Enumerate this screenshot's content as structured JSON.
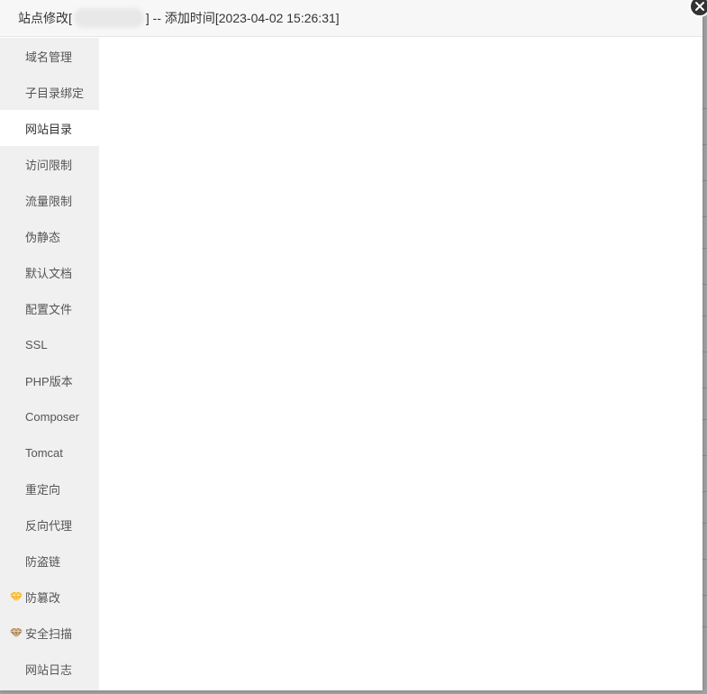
{
  "dialog": {
    "title_prefix": "站点修改[",
    "title_suffix": "] -- 添加时间[2023-04-02 15:26:31]",
    "close_icon": "close-icon"
  },
  "sidebar": {
    "items": [
      {
        "label": "域名管理"
      },
      {
        "label": "子目录绑定"
      },
      {
        "label": "网站目录"
      },
      {
        "label": "访问限制"
      },
      {
        "label": "流量限制"
      },
      {
        "label": "伪静态"
      },
      {
        "label": "默认文档"
      },
      {
        "label": "配置文件"
      },
      {
        "label": "SSL"
      },
      {
        "label": "PHP版本"
      },
      {
        "label": "Composer"
      },
      {
        "label": "Tomcat"
      },
      {
        "label": "重定向"
      },
      {
        "label": "反向代理"
      },
      {
        "label": "防盗链"
      },
      {
        "label": "防篡改",
        "icon": "gem-gold-icon"
      },
      {
        "label": "安全扫描",
        "icon": "gem-bronze-icon"
      },
      {
        "label": "网站日志"
      }
    ],
    "active_index": 2
  },
  "colors": {
    "gem_gold": "#f5b324",
    "gem_bronze": "#b0895a",
    "sidebar_bg": "#f0f0f0",
    "active_bg": "#ffffff"
  }
}
